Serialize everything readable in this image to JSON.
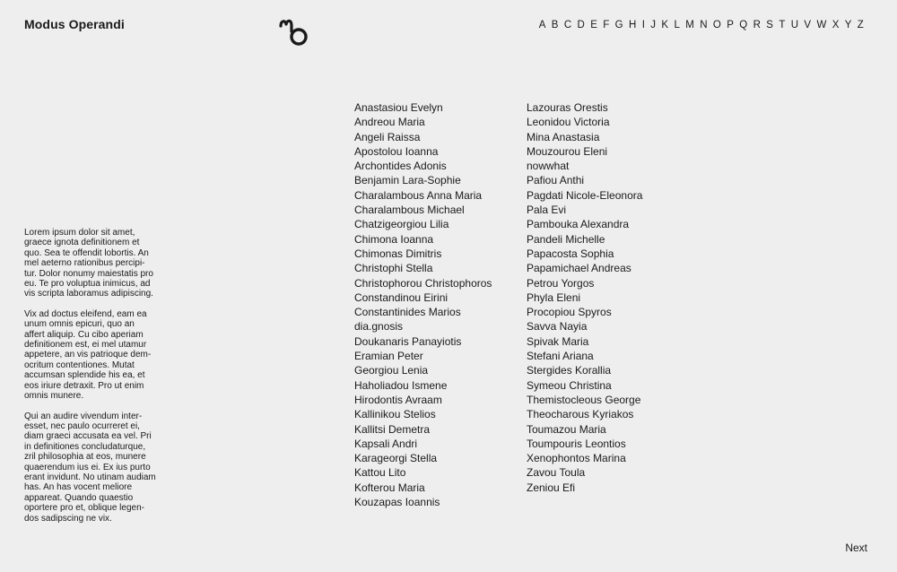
{
  "header": {
    "site_title": "Modus Operandi",
    "logo_icon": "mo-monogram-icon",
    "alphabet": [
      "A",
      "B",
      "C",
      "D",
      "E",
      "F",
      "G",
      "H",
      "I",
      "J",
      "K",
      "L",
      "M",
      "N",
      "O",
      "P",
      "Q",
      "R",
      "S",
      "T",
      "U",
      "V",
      "W",
      "X",
      "Y",
      "Z"
    ]
  },
  "intro": {
    "paragraphs": [
      "Lorem ipsum dolor sit amet,\ngraece ignota definitionem et\nquo. Sea te offendit lobortis. An\nmel aeterno rationibus percipi-\ntur. Dolor nonumy maiestatis pro\neu. Te pro voluptua inimicus, ad\nvis scripta laboramus adipiscing.",
      "Vix ad doctus eleifend, eam ea\nunum omnis epicuri, quo an\naffert aliquip. Cu cibo aperiam\ndefinitionem est, ei mel utamur\nappetere, an vis patrioque dem-\nocritum contentiones. Mutat\naccumsan splendide his ea, et\neos iriure detraxit. Pro ut enim\nomnis munere.",
      "Qui an audire vivendum inter-\nesset, nec paulo ocurreret ei,\ndiam graeci accusata ea vel. Pri\nin definitiones concludaturque,\nzril philosophia at eos, munere\nquaerendum ius ei. Ex ius purto\nerant invidunt. No utinam audiam\nhas. An has vocent meliore\nappareat. Quando quaestio\noportere pro et, oblique legen-\ndos sadipscing ne vix."
    ]
  },
  "names": {
    "column1": [
      "Anastasiou Evelyn",
      "Andreou Maria",
      "Angeli Raissa",
      "Apostolou Ioanna",
      "Archontides Adonis",
      "Benjamin Lara-Sophie",
      "Charalambous Anna Maria",
      "Charalambous Michael",
      "Chatzigeorgiou Lilia",
      "Chimona Ioanna",
      "Chimonas Dimitris",
      "Christophi Stella",
      "Christophorou Christophoros",
      "Constandinou Eirini",
      "Constantinides Marios",
      "dia.gnosis",
      "Doukanaris Panayiotis",
      "Eramian Peter",
      "Georgiou Lenia",
      "Haholiadou Ismene",
      "Hirodontis Avraam",
      "Kallinikou Stelios",
      "Kallitsi Demetra",
      "Kapsali Andri",
      "Karageorgi Stella",
      "Kattou Lito",
      "Kofterou Maria",
      "Kouzapas Ioannis"
    ],
    "column2": [
      "Lazouras Orestis",
      "Leonidou Victoria",
      "Mina Anastasia",
      "Mouzourou Eleni",
      "nowwhat",
      "Pafiou Anthi",
      "Pagdati Nicole-Eleonora",
      "Pala Evi",
      "Pambouka Alexandra",
      "Pandeli Michelle",
      "Papacosta Sophia",
      "Papamichael Andreas",
      "Petrou Yorgos",
      "Phyla Eleni",
      "Procopiou Spyros",
      "Savva Nayia",
      "Spivak Maria",
      "Stefani Ariana",
      "Stergides Korallia",
      "Symeou Christina",
      "Themistocleous George",
      "Theocharous Kyriakos",
      "Toumazou Maria",
      "Toumpouris Leontios",
      "Xenophontos Marina",
      "Zavou Toula",
      "Zeniou Efi"
    ]
  },
  "footer": {
    "next_label": "Next"
  }
}
